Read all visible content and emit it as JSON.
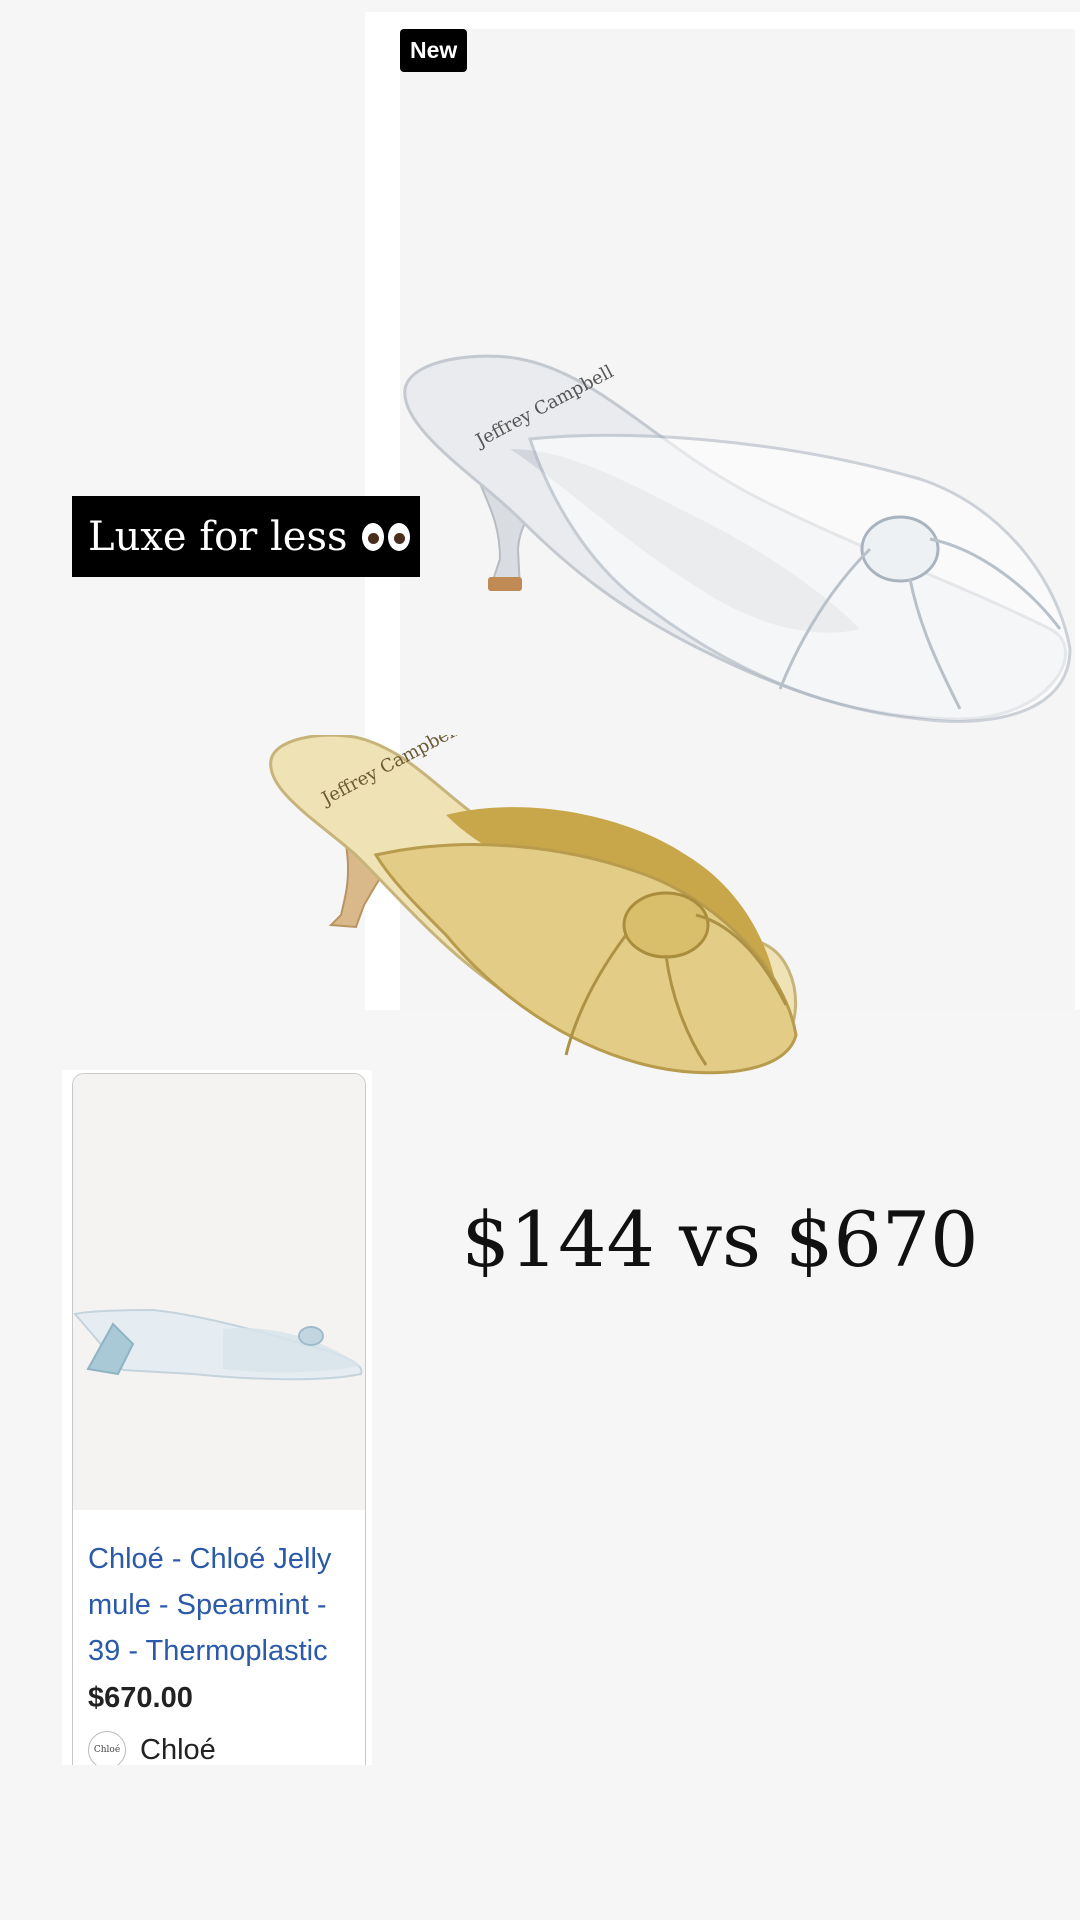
{
  "product_card_top": {
    "badge": "New",
    "image_icon": "clear-kitten-heel-mule-image",
    "insole_brand": "Jeffrey Campbell"
  },
  "caption": {
    "text": "Luxe for less",
    "emoji_icon": "eyes-emoji-icon"
  },
  "gold_shoe": {
    "image_icon": "gold-kitten-heel-mule-image",
    "insole_brand": "Jeffrey Campbell"
  },
  "comparison": {
    "text": "$144 vs $670"
  },
  "shop_card": {
    "image_icon": "chloe-jelly-mule-image",
    "title": "Chloé - Chloé Jelly mule - Spearmint - 39 - Thermoplastic",
    "price": "$670.00",
    "seller_logo_text": "Chloé",
    "seller_name": "Chloé"
  },
  "colors": {
    "background": "#f6f6f7",
    "badge": "#000000",
    "link": "#2a5aa8",
    "gold": "#d8c27a",
    "clear_mule": "#dfe3e8",
    "jelly_mint": "#a9c9d6"
  }
}
